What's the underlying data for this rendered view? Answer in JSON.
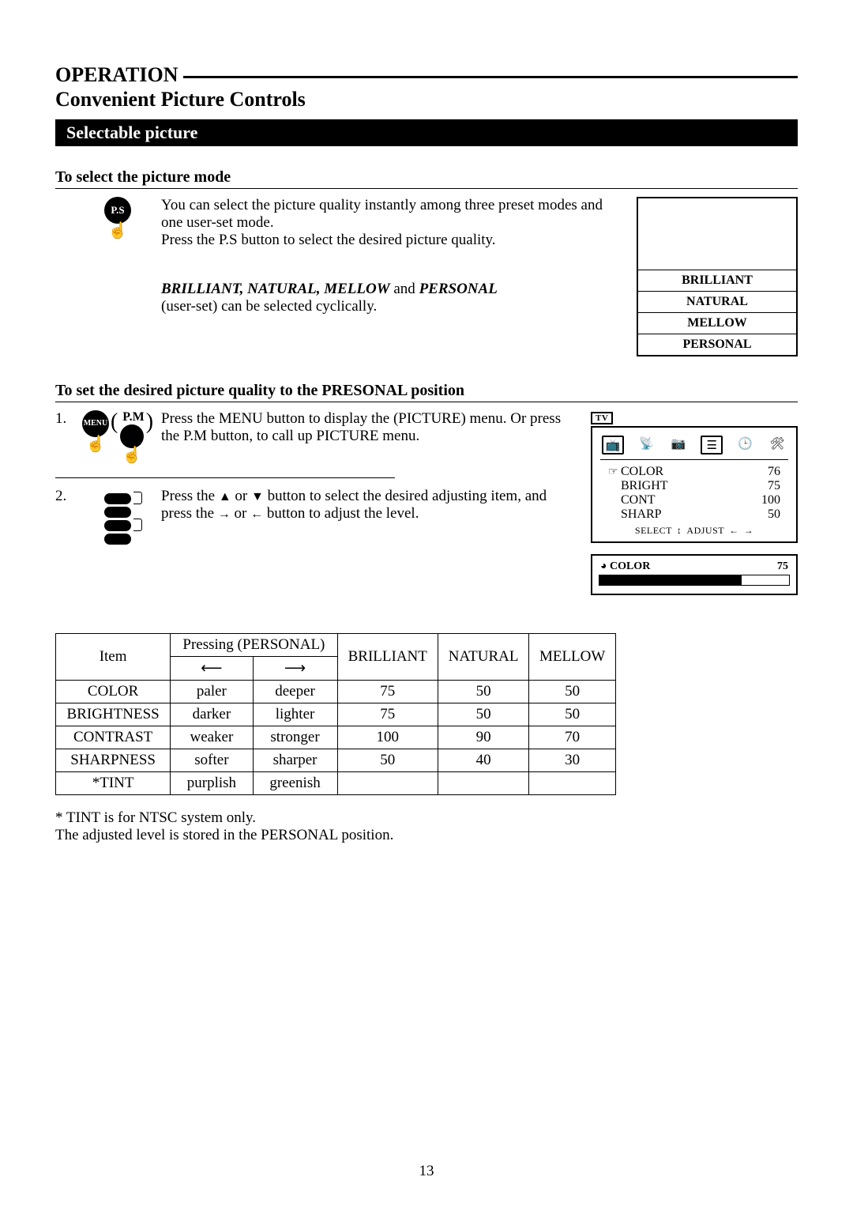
{
  "header": {
    "section": "OPERATION",
    "subtitle": "Convenient Picture Controls",
    "blackbar": "Selectable picture"
  },
  "s1": {
    "heading": "To select the picture mode",
    "p1": "You can select the picture quality instantly among three preset modes and one user-set mode.",
    "p2": "Press the P.S button to select the desired picture quality.",
    "modes_italic": "BRILLIANT, NATURAL, MELLOW",
    "modes_tail": " and ",
    "modes_personal": "PERSONAL",
    "modes_line2": "(user-set) can be selected cyclically.",
    "button_label": "P.S",
    "tvmodes": [
      "BRILLIANT",
      "NATURAL",
      "MELLOW",
      "PERSONAL"
    ]
  },
  "s2": {
    "heading": "To set the desired picture quality to the PRESONAL position",
    "step1_num": "1.",
    "step1_text": "Press the MENU button to display the (PICTURE) menu. Or press the P.M button, to call up PICTURE menu.",
    "menu_label": "MENU",
    "pm_label": "P.M",
    "step2_num": "2.",
    "step2_a": "Press the ",
    "step2_b": " or ",
    "step2_c": " button to select the desired adjusting item, and press the ",
    "step2_d": " or ",
    "step2_e": " button to adjust the level.",
    "tv_badge": "TV",
    "osd": {
      "items": [
        {
          "label": "COLOR",
          "value": "76",
          "pointer": true
        },
        {
          "label": "BRIGHT",
          "value": "75",
          "pointer": false
        },
        {
          "label": "CONT",
          "value": "100",
          "pointer": false
        },
        {
          "label": "SHARP",
          "value": "50",
          "pointer": false
        }
      ],
      "select_label": "SELECT",
      "adjust_label": "ADJUST"
    },
    "bar": {
      "label": "COLOR",
      "value": "75"
    }
  },
  "table": {
    "head_item": "Item",
    "head_pressing": "Pressing (PERSONAL)",
    "head_brilliant": "BRILLIANT",
    "head_natural": "NATURAL",
    "head_mellow": "MELLOW",
    "rows": [
      {
        "item": "COLOR",
        "left": "paler",
        "right": "deeper",
        "b": "75",
        "n": "50",
        "m": "50"
      },
      {
        "item": "BRIGHTNESS",
        "left": "darker",
        "right": "lighter",
        "b": "75",
        "n": "50",
        "m": "50"
      },
      {
        "item": "CONTRAST",
        "left": "weaker",
        "right": "stronger",
        "b": "100",
        "n": "90",
        "m": "70"
      },
      {
        "item": "SHARPNESS",
        "left": "softer",
        "right": "sharper",
        "b": "50",
        "n": "40",
        "m": "30"
      },
      {
        "item": "*TINT",
        "left": "purplish",
        "right": "greenish",
        "b": "",
        "n": "",
        "m": ""
      }
    ]
  },
  "foot": {
    "note1": "* TINT is for NTSC system only.",
    "note2": "The adjusted level is stored in the PERSONAL position."
  },
  "page_number": "13",
  "chart_data": {
    "type": "table",
    "title": "Picture mode preset values",
    "columns": [
      "Item",
      "Personal ←",
      "Personal →",
      "BRILLIANT",
      "NATURAL",
      "MELLOW"
    ],
    "rows": [
      [
        "COLOR",
        "paler",
        "deeper",
        75,
        50,
        50
      ],
      [
        "BRIGHTNESS",
        "darker",
        "lighter",
        75,
        50,
        50
      ],
      [
        "CONTRAST",
        "weaker",
        "stronger",
        100,
        90,
        70
      ],
      [
        "SHARPNESS",
        "softer",
        "sharper",
        50,
        40,
        30
      ],
      [
        "*TINT",
        "purplish",
        "greenish",
        null,
        null,
        null
      ]
    ]
  }
}
